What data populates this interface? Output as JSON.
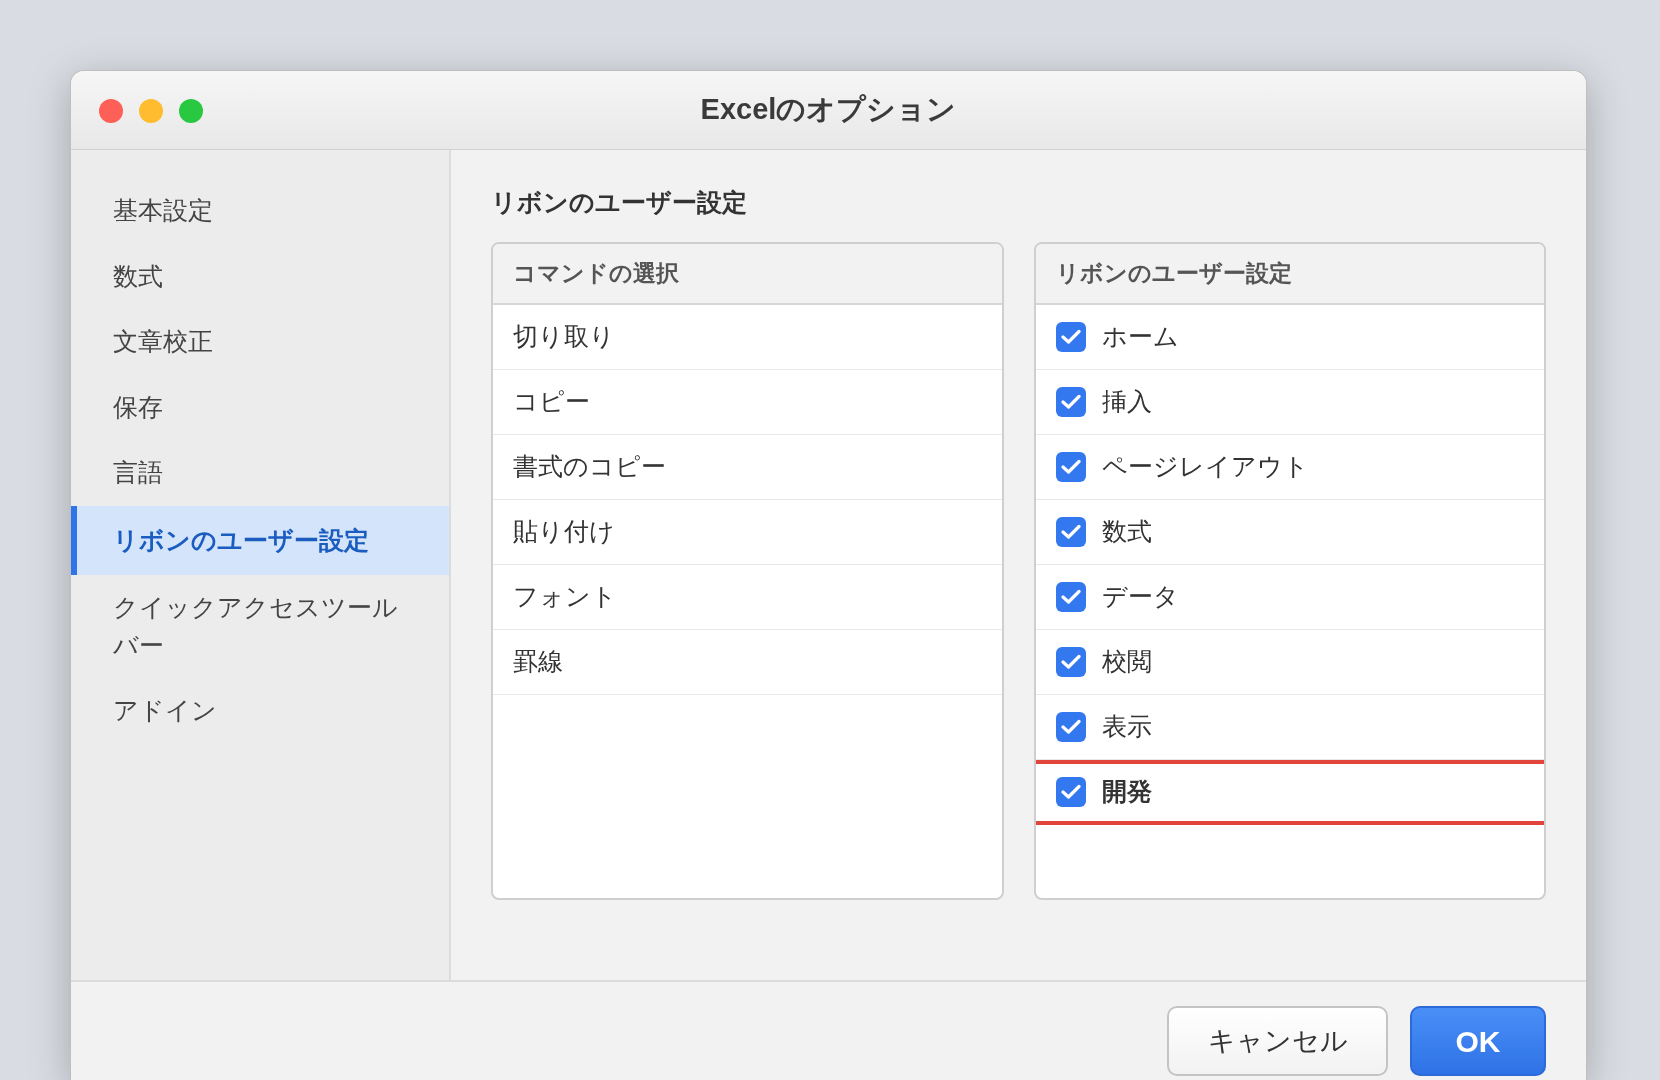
{
  "window": {
    "title": "Excelのオプション"
  },
  "sidebar": {
    "items": [
      {
        "label": "基本設定",
        "selected": false
      },
      {
        "label": "数式",
        "selected": false
      },
      {
        "label": "文章校正",
        "selected": false
      },
      {
        "label": "保存",
        "selected": false
      },
      {
        "label": "言語",
        "selected": false
      },
      {
        "label": "リボンのユーザー設定",
        "selected": true
      },
      {
        "label": "クイックアクセスツールバー",
        "selected": false
      },
      {
        "label": "アドイン",
        "selected": false
      }
    ]
  },
  "section_title": "リボンのユーザー設定",
  "commands": {
    "header": "コマンドの選択",
    "items": [
      "切り取り",
      "コピー",
      "書式のコピー",
      "貼り付け",
      "フォント",
      "罫線"
    ]
  },
  "ribbon": {
    "header": "リボンのユーザー設定",
    "items": [
      {
        "label": "ホーム",
        "checked": true,
        "highlighted": false
      },
      {
        "label": "挿入",
        "checked": true,
        "highlighted": false
      },
      {
        "label": "ページレイアウト",
        "checked": true,
        "highlighted": false
      },
      {
        "label": "数式",
        "checked": true,
        "highlighted": false
      },
      {
        "label": "データ",
        "checked": true,
        "highlighted": false
      },
      {
        "label": "校閲",
        "checked": true,
        "highlighted": false
      },
      {
        "label": "表示",
        "checked": true,
        "highlighted": false
      },
      {
        "label": "開発",
        "checked": true,
        "highlighted": true
      }
    ]
  },
  "buttons": [
    {
      "label": "キャンセル",
      "kind": "secondary"
    },
    {
      "label": "OK",
      "kind": "primary"
    }
  ]
}
